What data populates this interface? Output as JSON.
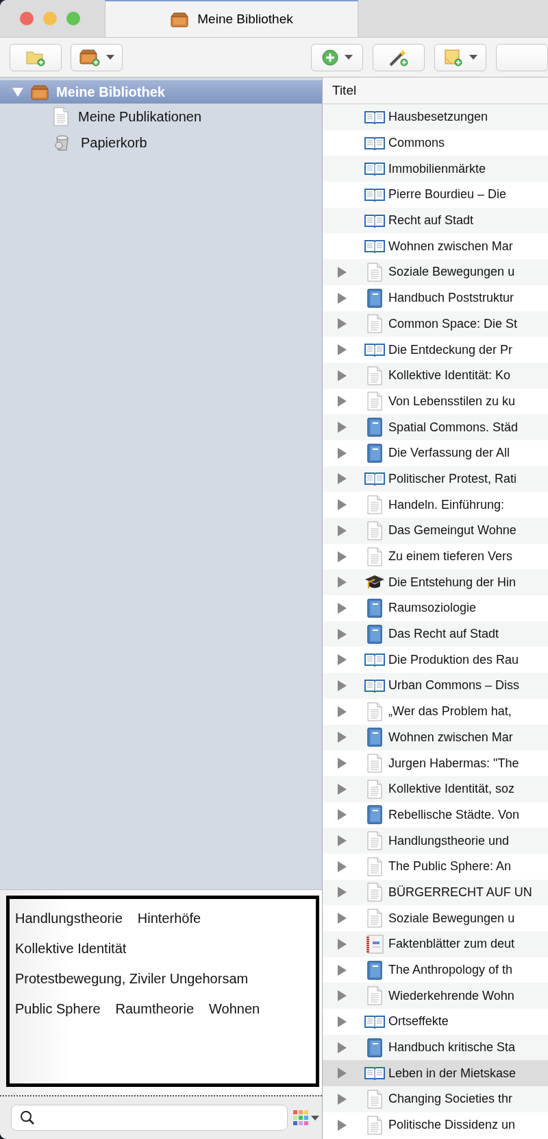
{
  "window": {
    "tabs": [
      {
        "label": "Meine Bibliothek",
        "selected": true
      }
    ]
  },
  "toolbar": {
    "left": [
      {
        "kind": "new_collection",
        "has_menu": false
      },
      {
        "kind": "new_library",
        "has_menu": true
      }
    ],
    "right": [
      {
        "kind": "new_item",
        "has_menu": true
      },
      {
        "kind": "add_by_identifier",
        "has_menu": false
      },
      {
        "kind": "new_note",
        "has_menu": true
      },
      {
        "kind": "partial",
        "has_menu": false
      }
    ]
  },
  "sidebar": {
    "tree": [
      {
        "label": "Meine Bibliothek",
        "kind": "library",
        "selected": true,
        "expanded": true,
        "children": [
          {
            "label": "Meine Publikationen",
            "kind": "publications",
            "selected": false
          },
          {
            "label": "Papierkorb",
            "kind": "trash",
            "selected": false
          }
        ]
      }
    ],
    "tags": [
      "Handlungstheorie",
      "Hinterhöfe",
      "Kollektive Identität",
      "Protestbewegung, Ziviler Ungehorsam",
      "Public Sphere",
      "Raumtheorie",
      "Wohnen"
    ]
  },
  "items": {
    "columns": [
      "Titel"
    ],
    "rows": [
      {
        "title": "Hausbesetzungen",
        "kind": "book_section",
        "expandable": false,
        "selected": false
      },
      {
        "title": "Commons",
        "kind": "book_section",
        "expandable": false,
        "selected": false
      },
      {
        "title": "Immobilienmärkte",
        "kind": "book_section",
        "expandable": false,
        "selected": false
      },
      {
        "title": "Pierre Bourdieu – Die",
        "kind": "book_section",
        "expandable": false,
        "selected": false
      },
      {
        "title": "Recht auf Stadt",
        "kind": "book_section",
        "expandable": false,
        "selected": false
      },
      {
        "title": "Wohnen zwischen Mar",
        "kind": "book_section",
        "expandable": false,
        "selected": false
      },
      {
        "title": "Soziale Bewegungen u",
        "kind": "document",
        "expandable": true,
        "selected": false
      },
      {
        "title": "Handbuch Poststruktur",
        "kind": "book",
        "expandable": true,
        "selected": false
      },
      {
        "title": "Common Space: Die St",
        "kind": "document",
        "expandable": true,
        "selected": false
      },
      {
        "title": "Die Entdeckung der Pr",
        "kind": "book_section",
        "expandable": true,
        "selected": false
      },
      {
        "title": "Kollektive Identität: Ko",
        "kind": "document",
        "expandable": true,
        "selected": false
      },
      {
        "title": "Von Lebensstilen zu ku",
        "kind": "document",
        "expandable": true,
        "selected": false
      },
      {
        "title": "Spatial Commons. Städ",
        "kind": "book",
        "expandable": true,
        "selected": false
      },
      {
        "title": "Die Verfassung der All",
        "kind": "book",
        "expandable": true,
        "selected": false
      },
      {
        "title": "Politischer Protest, Rati",
        "kind": "book_section",
        "expandable": true,
        "selected": false
      },
      {
        "title": "Handeln. Einführung:",
        "kind": "document",
        "expandable": true,
        "selected": false
      },
      {
        "title": "Das Gemeingut Wohne",
        "kind": "document",
        "expandable": true,
        "selected": false
      },
      {
        "title": "Zu einem tieferen Vers",
        "kind": "document",
        "expandable": true,
        "selected": false
      },
      {
        "title": "Die Entstehung der Hin",
        "kind": "thesis",
        "expandable": true,
        "selected": false
      },
      {
        "title": "Raumsoziologie",
        "kind": "book",
        "expandable": true,
        "selected": false
      },
      {
        "title": "Das Recht auf Stadt",
        "kind": "book",
        "expandable": true,
        "selected": false
      },
      {
        "title": "Die Produktion des Rau",
        "kind": "book_section",
        "expandable": true,
        "selected": false
      },
      {
        "title": "Urban Commons – Diss",
        "kind": "book_section",
        "expandable": true,
        "selected": false
      },
      {
        "title": "„Wer das Problem hat,",
        "kind": "document",
        "expandable": true,
        "selected": false
      },
      {
        "title": "Wohnen zwischen Mar",
        "kind": "book",
        "expandable": true,
        "selected": false
      },
      {
        "title": "Jurgen Habermas: \"The",
        "kind": "document",
        "expandable": true,
        "selected": false
      },
      {
        "title": "Kollektive Identität, soz",
        "kind": "document",
        "expandable": true,
        "selected": false
      },
      {
        "title": "Rebellische Städte. Von",
        "kind": "book",
        "expandable": true,
        "selected": false
      },
      {
        "title": "Handlungstheorie und",
        "kind": "document",
        "expandable": true,
        "selected": false
      },
      {
        "title": "The Public Sphere: An",
        "kind": "document",
        "expandable": true,
        "selected": false
      },
      {
        "title": "BÜRGERRECHT AUF UN",
        "kind": "document",
        "expandable": true,
        "selected": false
      },
      {
        "title": "Soziale Bewegungen u",
        "kind": "document",
        "expandable": true,
        "selected": false
      },
      {
        "title": "Faktenblätter zum deut",
        "kind": "report",
        "expandable": true,
        "selected": false
      },
      {
        "title": "The Anthropology of th",
        "kind": "book",
        "expandable": true,
        "selected": false
      },
      {
        "title": "Wiederkehrende Wohn",
        "kind": "document",
        "expandable": true,
        "selected": false
      },
      {
        "title": "Ortseffekte",
        "kind": "book_section",
        "expandable": true,
        "selected": false
      },
      {
        "title": "Handbuch kritische Sta",
        "kind": "book",
        "expandable": true,
        "selected": false
      },
      {
        "title": "Leben in der Mietskase",
        "kind": "book_section",
        "expandable": true,
        "selected": true
      },
      {
        "title": "Changing Societies thr",
        "kind": "document",
        "expandable": true,
        "selected": false
      },
      {
        "title": "Politische Dissidenz un",
        "kind": "document",
        "expandable": true,
        "selected": false
      }
    ]
  }
}
